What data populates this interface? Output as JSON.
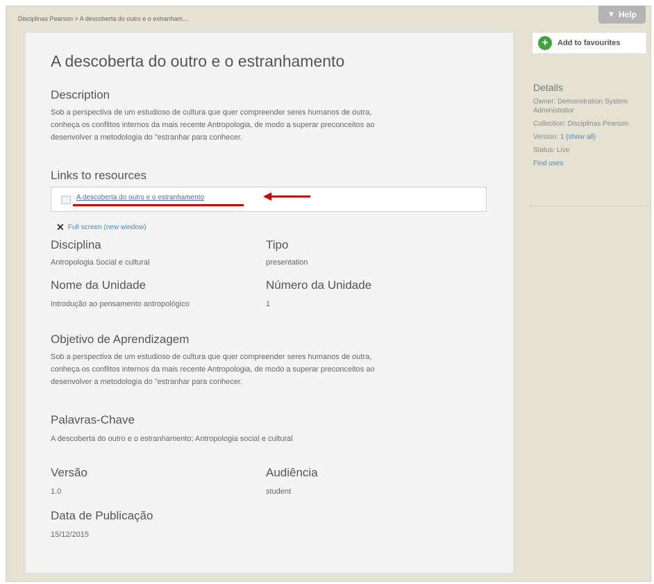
{
  "breadcrumb": "Disciplinas Pearson > A descoberta do outro e o estranham...",
  "help_label": "Help",
  "title": "A descoberta do outro e o estranhamento",
  "description": {
    "heading": "Description",
    "lines": [
      "Sob a perspectiva de um estudioso de cultura que quer compreender seres humanos de outra,",
      "conheça os conflitos internos da mais recente Antropologia, de modo a superar preconceitos ao",
      "desenvolver a metodologia do \"estranhar para conhecer."
    ]
  },
  "links": {
    "heading": "Links to resources",
    "resource_label": "A descoberta do outro e o estranhamento",
    "fullscreen_label": "Full screen (new window)"
  },
  "fields": {
    "disciplina": {
      "label": "Disciplina",
      "value": "Antropologia Social e cultural"
    },
    "tipo": {
      "label": "Tipo",
      "value": "presentation"
    },
    "nome_unidade": {
      "label": "Nome da Unidade",
      "value": "Introdução ao pensamento antropológico"
    },
    "numero_unidade": {
      "label": "Número da Unidade",
      "value": "1"
    },
    "objetivo": {
      "label": "Objetivo de Aprendizagem",
      "lines": [
        "Sob a perspectiva de um estudioso de cultura que quer compreender seres humanos de outra,",
        "conheça os conflitos internos da mais recente Antropologia, de modo a superar preconceitos ao",
        "desenvolver a metodologia do \"estranhar para conhecer."
      ]
    },
    "palavras": {
      "label": "Palavras-Chave",
      "value": "A descoberta do outro e o estranhamento; Antropologia social e cultural"
    },
    "versao": {
      "label": "Versão",
      "value": "1.0"
    },
    "audiencia": {
      "label": "Audiência",
      "value": "student"
    },
    "data": {
      "label": "Data de Publicação",
      "value": "15/12/2015"
    }
  },
  "sidebar": {
    "fav_label": "Add to favourites",
    "details_heading": "Details",
    "owner": "Owner: Demonstration System Administrator",
    "collection": "Collection: Disciplinas Pearson",
    "version_prefix": "Version: ",
    "version_link": "1 (show all)",
    "status": "Status: Live",
    "find_uses": "Find uses"
  },
  "colors": {
    "accent_link": "#4a8ac8",
    "annotation_red": "#cc0000",
    "fav_green": "#3ea23e"
  }
}
